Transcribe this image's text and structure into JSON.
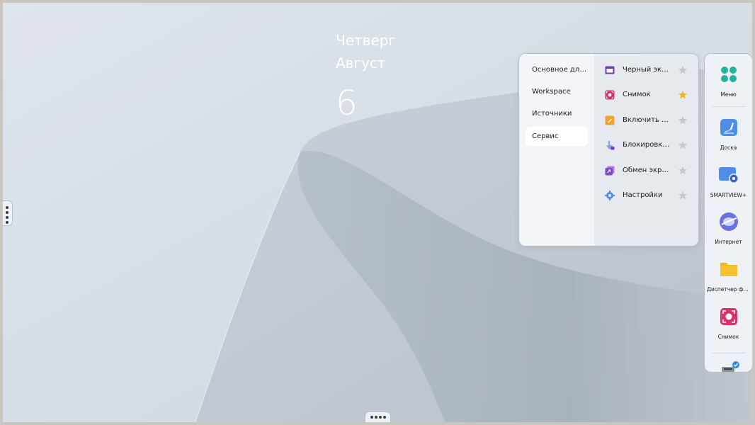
{
  "clock": {
    "day_of_week": "Четверг",
    "month": "Август",
    "day": "6"
  },
  "panel": {
    "categories": [
      {
        "label": "Основное для ...",
        "active": false
      },
      {
        "label": "Workspace",
        "active": false
      },
      {
        "label": "Источники",
        "active": false
      },
      {
        "label": "Сервис",
        "active": true
      }
    ],
    "items": [
      {
        "label": "Черный экран",
        "icon": "black-screen-icon",
        "favorite": false
      },
      {
        "label": "Снимок",
        "icon": "capture-icon",
        "favorite": true
      },
      {
        "label": "Включить зам...",
        "icon": "lock-note-icon",
        "favorite": false
      },
      {
        "label": "Блокировка с...",
        "icon": "touch-lock-icon",
        "favorite": false
      },
      {
        "label": "Обмен экран...",
        "icon": "screen-share-icon",
        "favorite": false
      },
      {
        "label": "Настройки",
        "icon": "gear-icon",
        "favorite": false
      }
    ]
  },
  "dock": {
    "items": [
      {
        "label": "Меню",
        "icon": "menu-dots-icon"
      },
      {
        "label": "Доска",
        "icon": "whiteboard-icon"
      },
      {
        "label": "SMARTVIEW+",
        "icon": "smartview-icon"
      },
      {
        "label": "Интернет",
        "icon": "internet-icon"
      },
      {
        "label": "Диспетчер фай...",
        "icon": "folder-icon"
      },
      {
        "label": "Снимок",
        "icon": "capture-icon"
      }
    ]
  },
  "colors": {
    "accent_teal": "#22b39c",
    "star_active": "#f2b51c",
    "star_inactive": "#c4c9d0",
    "capture_pink": "#d8326a",
    "folder_yellow": "#f2b81f",
    "note_orange": "#f0a429",
    "purple": "#7a4bc4",
    "blue": "#4f8ee8"
  }
}
